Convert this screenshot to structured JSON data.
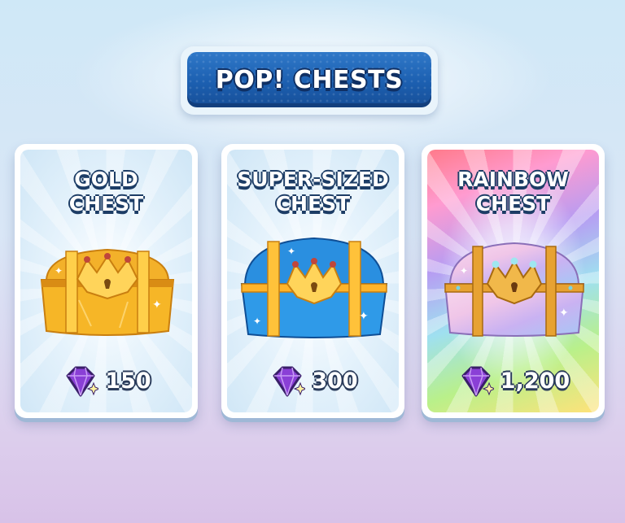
{
  "header": {
    "title": "POP! CHESTS"
  },
  "colors": {
    "banner": "#1c5fb0",
    "gold_chest": "#f5a623",
    "super_chest": "#2a8fe0",
    "gem": "#8a3fd6"
  },
  "chests": [
    {
      "title_line1": "GOLD",
      "title_line2": "CHEST",
      "price": "150",
      "variant": "gold",
      "currency_icon": "purple-gem-icon"
    },
    {
      "title_line1": "SUPER-SIZED",
      "title_line2": "CHEST",
      "price": "300",
      "variant": "super-sized",
      "currency_icon": "purple-gem-icon"
    },
    {
      "title_line1": "RAINBOW",
      "title_line2": "CHEST",
      "price": "1,200",
      "variant": "rainbow",
      "currency_icon": "purple-gem-icon"
    }
  ]
}
